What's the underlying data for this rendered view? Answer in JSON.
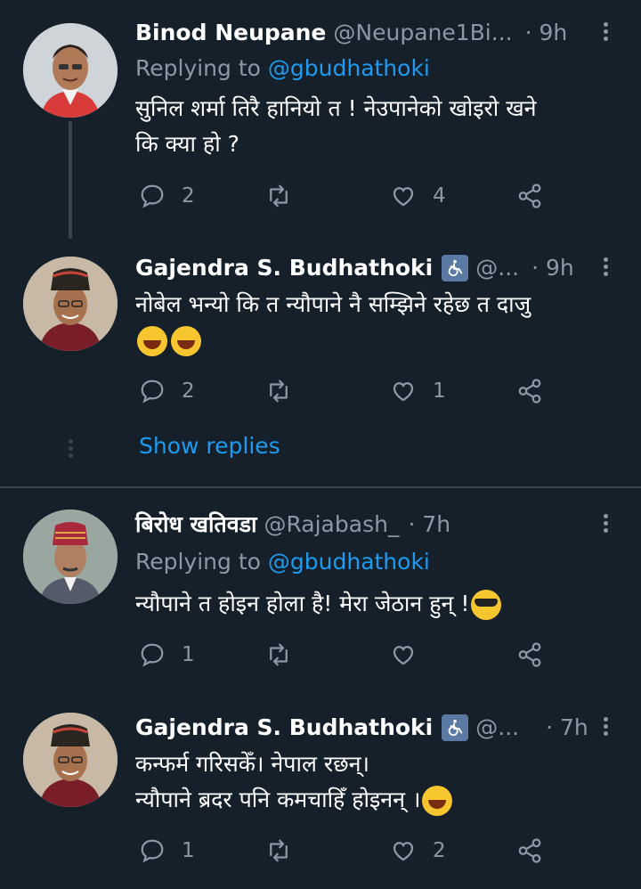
{
  "tweets": [
    {
      "name": "Binod Neupane",
      "handle": "@Neupane1Bi...",
      "time": "· 9h",
      "replying_prefix": "Replying to ",
      "replying_handle": "@gbudhathoki",
      "text_line1": "सुनिल शर्मा तिरै हानियो त ! नेउपानेको खोइरो खने",
      "text_line2": "कि क्या हो ?",
      "replies": "2",
      "retweets": "",
      "likes": "4"
    },
    {
      "name": "Gajendra S. Budhathoki",
      "handle": "@...",
      "time": "· 9h",
      "text_line1": "नोबेल भन्यो कि त न्यौपाने नै सम्झिने रहेछ त दाजु",
      "replies": "2",
      "retweets": "",
      "likes": "1"
    },
    {
      "name": "बिरोध खतिवडा",
      "handle": "@Rajabash_",
      "time": "· 7h",
      "replying_prefix": "Replying to ",
      "replying_handle": "@gbudhathoki",
      "text_line1": "न्यौपाने त होइन होला है! मेरा जेठान हुन् !",
      "replies": "1",
      "retweets": "",
      "likes": ""
    },
    {
      "name": "Gajendra S. Budhathoki",
      "handle": "@...",
      "time": "· 7h",
      "text_line1": "कन्फर्म गरिसकेँ। नेपाल रछन्।",
      "text_line2": "न्यौपाने ब्रदर पनि कमचाहिँ होइनन् ।",
      "replies": "1",
      "retweets": "",
      "likes": "2"
    }
  ],
  "show_replies": "Show replies",
  "badge_icon": "wheelchair-icon",
  "colors": {
    "background": "#15202b",
    "accent": "#1d9bf0",
    "muted": "#8b98a5",
    "border": "#38444d"
  }
}
